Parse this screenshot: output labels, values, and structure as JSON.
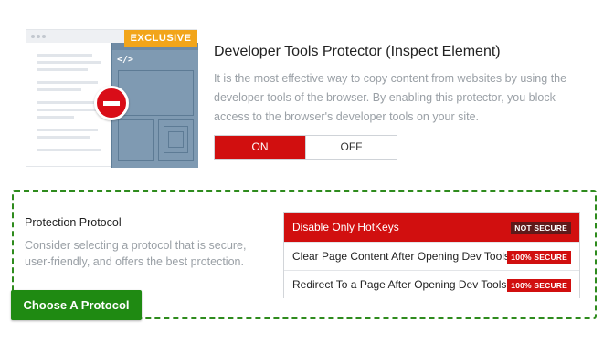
{
  "illustration": {
    "badge": "EXCLUSIVE",
    "code_symbol": "</>",
    "colors": {
      "badge": "#f2a51a",
      "panel": "#7f9ab2",
      "stop": "#d90d18"
    },
    "icons": [
      "browser-window-icon",
      "devtools-panel-icon",
      "stop-sign-icon"
    ]
  },
  "feature": {
    "title": "Developer Tools Protector (Inspect Element)",
    "description": "It is the most effective way to copy content from websites by using the developer tools of the browser. By enabling this protector, you block access to the browser's developer tools on your site.",
    "toggle": {
      "on_label": "ON",
      "off_label": "OFF",
      "selected": "ON"
    }
  },
  "protocol": {
    "title": "Protection Protocol",
    "description": "Consider selecting a protocol that is secure, user-friendly, and offers the best protection.",
    "button_label": "Choose A Protocol",
    "options": [
      {
        "label": "Disable Only HotKeys",
        "badge": "NOT SECURE",
        "selected": true
      },
      {
        "label": "Clear Page Content After Opening Dev Tools",
        "badge": "100% SECURE",
        "selected": false
      },
      {
        "label": "Redirect To a Page After Opening Dev Tools",
        "badge": "100% SECURE",
        "selected": false
      }
    ]
  },
  "colors": {
    "accent_red": "#d10f0f",
    "accent_green": "#1f8a12",
    "dashed_border": "#2e8b1d"
  }
}
